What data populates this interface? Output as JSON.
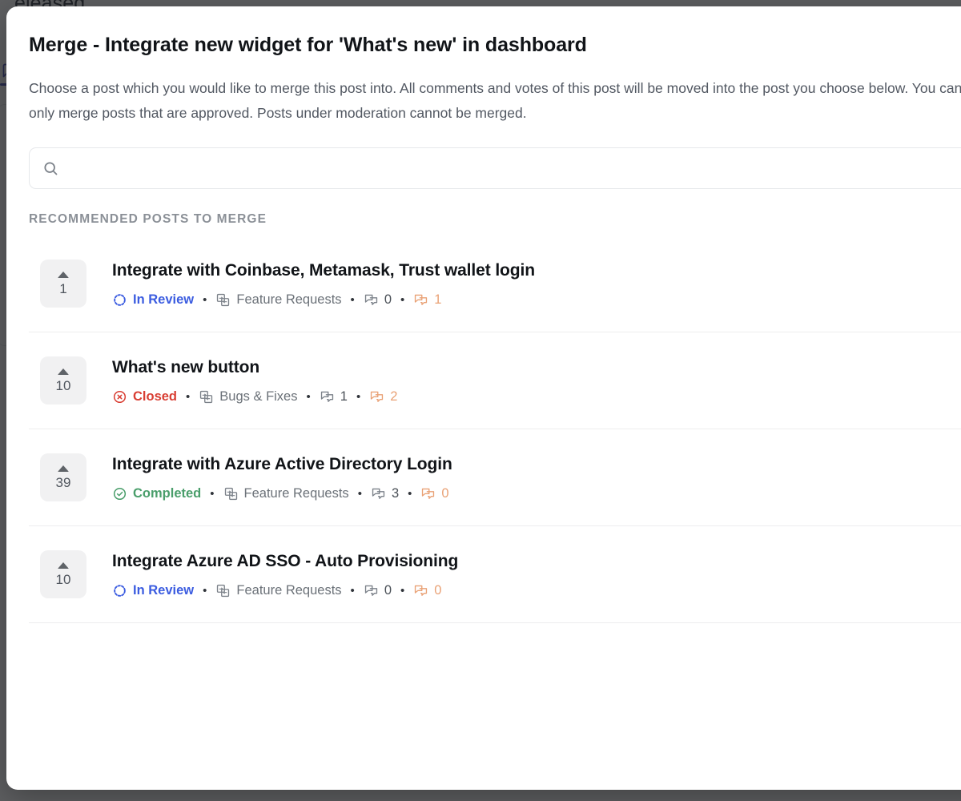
{
  "background": {
    "heading_fragment": "eleased",
    "tab_icon": "comment-icon",
    "accent": "#3d44b5"
  },
  "modal": {
    "title": "Merge - Integrate new widget for 'What's new' in dashboard",
    "description": "Choose a post which you would like to merge this post into. All comments and votes of this post will be moved into the post you choose below. You can only merge posts that are approved. Posts under moderation cannot be merged.",
    "search": {
      "icon": "search-icon",
      "value": "",
      "placeholder": ""
    },
    "section_label": "RECOMMENDED POSTS TO MERGE",
    "icons": {
      "vote": "caret-up-icon",
      "category": "board-transfer-icon",
      "comments": "comment-bubbles-icon",
      "internal_comments": "comment-bubbles-icon"
    },
    "status_colors": {
      "in_review": "#3b5ce0",
      "closed": "#d93f34",
      "completed": "#4a9e6b"
    },
    "accent_orange": "#e9a175",
    "posts": [
      {
        "votes": "1",
        "title": "Integrate with Coinbase, Metamask, Trust wallet login",
        "status": "In Review",
        "status_key": "in_review",
        "status_icon": "in-review-dashed-circle-icon",
        "category": "Feature Requests",
        "comments": "0",
        "internal_comments": "1"
      },
      {
        "votes": "10",
        "title": "What's new button",
        "status": "Closed",
        "status_key": "closed",
        "status_icon": "closed-circle-x-icon",
        "category": "Bugs & Fixes",
        "comments": "1",
        "internal_comments": "2"
      },
      {
        "votes": "39",
        "title": "Integrate with Azure Active Directory Login",
        "status": "Completed",
        "status_key": "completed",
        "status_icon": "completed-circle-check-icon",
        "category": "Feature Requests",
        "comments": "3",
        "internal_comments": "0"
      },
      {
        "votes": "10",
        "title": "Integrate Azure AD SSO - Auto Provisioning",
        "status": "In Review",
        "status_key": "in_review",
        "status_icon": "in-review-dashed-circle-icon",
        "category": "Feature Requests",
        "comments": "0",
        "internal_comments": "0"
      }
    ]
  }
}
